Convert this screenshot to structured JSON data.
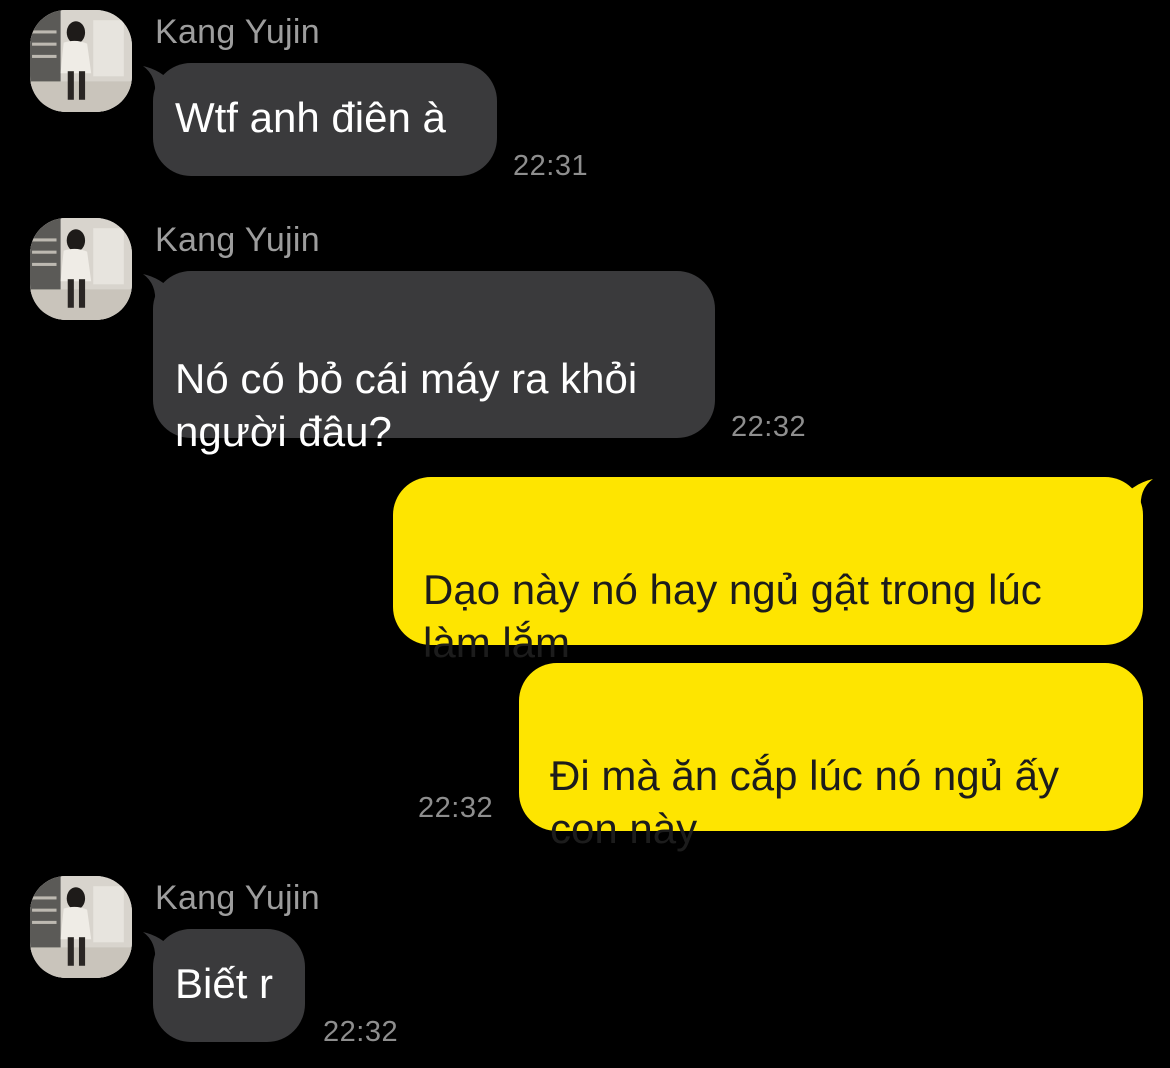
{
  "contact": {
    "name": "Kang Yujin"
  },
  "messages": [
    {
      "direction": "incoming",
      "sender": "Kang Yujin",
      "text": "Wtf anh điên à",
      "time": "22:31"
    },
    {
      "direction": "incoming",
      "sender": "Kang Yujin",
      "text": "Nó có bỏ cái máy ra khỏi\nngười đâu?",
      "time": "22:32"
    },
    {
      "direction": "outgoing",
      "text": "Dạo này nó hay ngủ gật trong lúc\nlàm lắm",
      "time": ""
    },
    {
      "direction": "outgoing",
      "text": "Đi mà ăn cắp lúc nó ngủ ấy\ncon này",
      "time": "22:32"
    },
    {
      "direction": "incoming",
      "sender": "Kang Yujin",
      "text": "Biết r",
      "time": "22:32"
    }
  ],
  "colors": {
    "background": "#000000",
    "incoming_bubble": "#3a3a3c",
    "outgoing_bubble": "#fee500",
    "sender_text": "#9d9d9d",
    "time_text": "#8e8e8e"
  },
  "icons": {
    "avatar": "profile-photo"
  }
}
